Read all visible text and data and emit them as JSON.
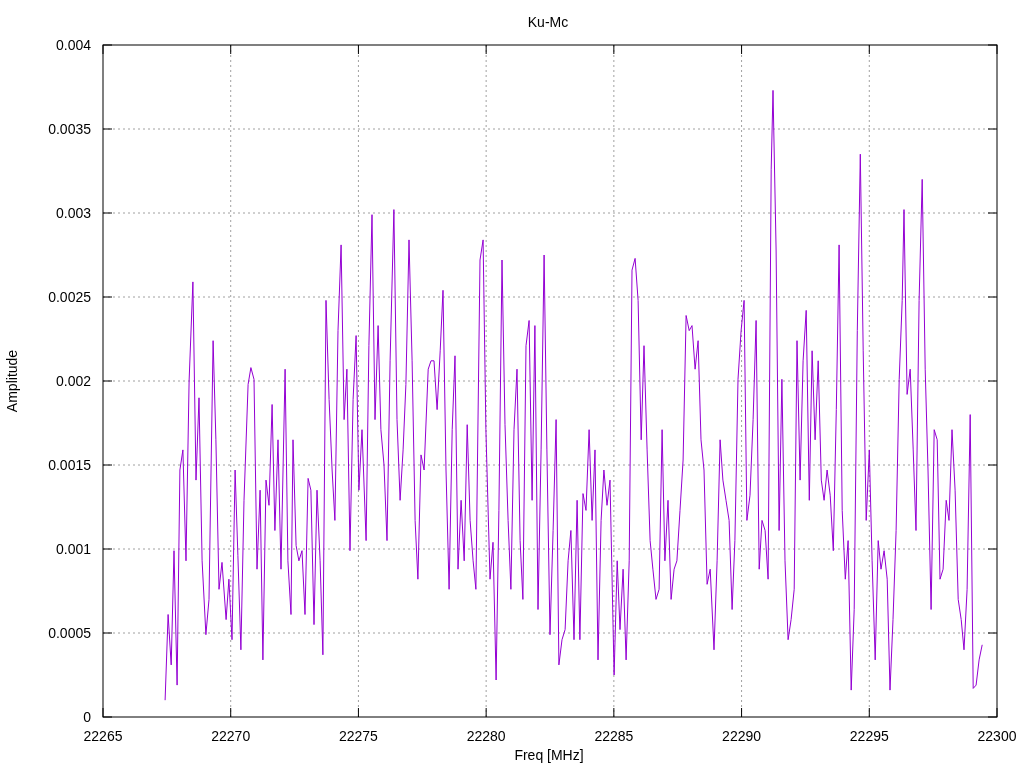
{
  "chart_data": {
    "type": "line",
    "grid": true,
    "title": "Ku-Mc",
    "xlabel": "Freq [MHz]",
    "ylabel": "Amplitude",
    "xlim": [
      22265,
      22300
    ],
    "ylim": [
      0,
      0.004
    ],
    "xticks": [
      22265,
      22270,
      22275,
      22280,
      22285,
      22290,
      22295,
      22300
    ],
    "yticks": [
      0,
      0.0005,
      0.001,
      0.0015,
      0.002,
      0.0025,
      0.003,
      0.0035,
      0.004
    ],
    "x": [
      22267.43,
      22267.55,
      22267.67,
      22267.78,
      22267.9,
      22268.01,
      22268.13,
      22268.25,
      22268.37,
      22268.52,
      22268.64,
      22268.76,
      22268.88,
      22269.03,
      22269.15,
      22269.31,
      22269.42,
      22269.54,
      22269.66,
      22269.82,
      22269.93,
      22270.05,
      22270.17,
      22270.28,
      22270.4,
      22270.52,
      22270.68,
      22270.79,
      22270.91,
      22271.03,
      22271.15,
      22271.26,
      22271.38,
      22271.5,
      22271.62,
      22271.73,
      22271.85,
      22271.97,
      22272.13,
      22272.24,
      22272.36,
      22272.44,
      22272.56,
      22272.67,
      22272.79,
      22272.91,
      22273.03,
      22273.14,
      22273.26,
      22273.38,
      22273.5,
      22273.61,
      22273.73,
      22273.85,
      22273.97,
      22274.08,
      22274.2,
      22274.32,
      22274.44,
      22274.55,
      22274.67,
      22274.79,
      22274.91,
      22275.02,
      22275.14,
      22275.3,
      22275.41,
      22275.53,
      22275.65,
      22275.77,
      22275.88,
      22276.0,
      22276.12,
      22276.24,
      22276.39,
      22276.51,
      22276.63,
      22276.75,
      22276.86,
      22276.98,
      22277.1,
      22277.22,
      22277.33,
      22277.45,
      22277.57,
      22277.73,
      22277.84,
      22277.96,
      22278.08,
      22278.2,
      22278.31,
      22278.43,
      22278.55,
      22278.67,
      22278.78,
      22278.9,
      22279.02,
      22279.14,
      22279.26,
      22279.37,
      22279.49,
      22279.6,
      22279.76,
      22279.88,
      22279.99,
      22280.15,
      22280.27,
      22280.39,
      22280.5,
      22280.62,
      22280.74,
      22280.86,
      22280.97,
      22281.09,
      22281.21,
      22281.33,
      22281.44,
      22281.56,
      22281.68,
      22281.8,
      22281.91,
      22282.03,
      22282.15,
      22282.27,
      22282.38,
      22282.5,
      22282.62,
      22282.74,
      22282.85,
      22282.97,
      22283.09,
      22283.21,
      22283.32,
      22283.44,
      22283.56,
      22283.67,
      22283.79,
      22283.91,
      22284.03,
      22284.15,
      22284.26,
      22284.38,
      22284.5,
      22284.61,
      22284.73,
      22284.85,
      22285.01,
      22285.13,
      22285.24,
      22285.36,
      22285.48,
      22285.6,
      22285.71,
      22285.83,
      22285.95,
      22286.07,
      22286.18,
      22286.3,
      22286.42,
      22286.53,
      22286.65,
      22286.77,
      22286.89,
      22287.0,
      22287.12,
      22287.24,
      22287.36,
      22287.47,
      22287.59,
      22287.71,
      22287.83,
      22287.95,
      22288.06,
      22288.18,
      22288.3,
      22288.41,
      22288.53,
      22288.65,
      22288.77,
      22288.92,
      22289.04,
      22289.16,
      22289.27,
      22289.39,
      22289.51,
      22289.63,
      22289.74,
      22289.86,
      22289.98,
      22290.1,
      22290.21,
      22290.33,
      22290.45,
      22290.57,
      22290.69,
      22290.8,
      22290.92,
      22291.04,
      22291.16,
      22291.23,
      22291.35,
      22291.47,
      22291.58,
      22291.7,
      22291.82,
      22291.94,
      22292.06,
      22292.17,
      22292.29,
      22292.41,
      22292.53,
      22292.65,
      22292.76,
      22292.88,
      22293.0,
      22293.12,
      22293.23,
      22293.35,
      22293.47,
      22293.59,
      22293.71,
      22293.82,
      22293.94,
      22294.06,
      22294.17,
      22294.29,
      22294.41,
      22294.53,
      22294.65,
      22294.76,
      22294.88,
      22295.0,
      22295.11,
      22295.23,
      22295.35,
      22295.46,
      22295.58,
      22295.7,
      22295.81,
      22295.93,
      22296.05,
      22296.17,
      22296.29,
      22296.36,
      22296.48,
      22296.6,
      22296.72,
      22296.83,
      22296.95,
      22297.07,
      22297.19,
      22297.3,
      22297.42,
      22297.54,
      22297.66,
      22297.77,
      22297.89,
      22298.01,
      22298.12,
      22298.24,
      22298.36,
      22298.48,
      22298.6,
      22298.71,
      22298.83,
      22298.95,
      22299.07,
      22299.18,
      22299.3,
      22299.42
    ],
    "series": [
      {
        "color": "#9400d3",
        "values": [
          0.0001,
          0.00061,
          0.00031,
          0.00099,
          0.00019,
          0.00147,
          0.00159,
          0.00093,
          0.002,
          0.00259,
          0.00141,
          0.0019,
          0.00093,
          0.00049,
          0.0007,
          0.00224,
          0.00165,
          0.00076,
          0.00092,
          0.00058,
          0.00082,
          0.00046,
          0.00147,
          0.00096,
          0.0004,
          0.00129,
          0.00198,
          0.00208,
          0.00201,
          0.00088,
          0.00135,
          0.00034,
          0.00141,
          0.00126,
          0.00186,
          0.00111,
          0.00165,
          0.00088,
          0.00207,
          0.00093,
          0.00061,
          0.00165,
          0.00102,
          0.00093,
          0.00099,
          0.00061,
          0.00142,
          0.00135,
          0.00055,
          0.00135,
          0.00093,
          0.00037,
          0.00248,
          0.00189,
          0.00147,
          0.00117,
          0.0023,
          0.00281,
          0.00177,
          0.00207,
          0.00099,
          0.00189,
          0.00227,
          0.00135,
          0.00171,
          0.00105,
          0.00221,
          0.00299,
          0.00177,
          0.00233,
          0.00171,
          0.0015,
          0.00105,
          0.00212,
          0.00302,
          0.00177,
          0.00129,
          0.00159,
          0.00198,
          0.00284,
          0.00212,
          0.00117,
          0.00082,
          0.00156,
          0.00147,
          0.00207,
          0.00212,
          0.00212,
          0.00183,
          0.00218,
          0.00254,
          0.00147,
          0.00076,
          0.00171,
          0.00215,
          0.00088,
          0.00129,
          0.00093,
          0.00174,
          0.00117,
          0.00093,
          0.00076,
          0.00272,
          0.00284,
          0.00171,
          0.00082,
          0.00104,
          0.00022,
          0.00123,
          0.00272,
          0.00174,
          0.00117,
          0.00076,
          0.00171,
          0.00207,
          0.00105,
          0.0007,
          0.00221,
          0.00236,
          0.00129,
          0.00233,
          0.00064,
          0.00159,
          0.00275,
          0.00159,
          0.00049,
          0.00111,
          0.00177,
          0.00031,
          0.00046,
          0.00052,
          0.00093,
          0.00111,
          0.00046,
          0.00129,
          0.00046,
          0.00133,
          0.00123,
          0.00171,
          0.00117,
          0.00159,
          0.00034,
          0.00117,
          0.00147,
          0.00126,
          0.00141,
          0.00025,
          0.00093,
          0.00052,
          0.00088,
          0.00034,
          0.00093,
          0.00266,
          0.00273,
          0.00248,
          0.00165,
          0.00221,
          0.00159,
          0.00105,
          0.00088,
          0.0007,
          0.00076,
          0.00171,
          0.00093,
          0.00129,
          0.0007,
          0.00088,
          0.00093,
          0.00123,
          0.00153,
          0.00239,
          0.0023,
          0.00233,
          0.00207,
          0.00224,
          0.00165,
          0.00147,
          0.00079,
          0.00088,
          0.0004,
          0.00093,
          0.00165,
          0.00141,
          0.00129,
          0.00117,
          0.00064,
          0.00105,
          0.00201,
          0.0023,
          0.00248,
          0.00117,
          0.00132,
          0.00177,
          0.00236,
          0.00088,
          0.00117,
          0.00111,
          0.00082,
          0.00326,
          0.00373,
          0.00278,
          0.00111,
          0.00201,
          0.00093,
          0.00046,
          0.00058,
          0.00076,
          0.00224,
          0.00141,
          0.00212,
          0.00242,
          0.00129,
          0.00218,
          0.00165,
          0.00212,
          0.00141,
          0.00129,
          0.00147,
          0.00132,
          0.00099,
          0.00183,
          0.00281,
          0.00123,
          0.00082,
          0.00105,
          0.00016,
          0.00064,
          0.0023,
          0.00335,
          0.00218,
          0.00117,
          0.00159,
          0.00093,
          0.00034,
          0.00105,
          0.00088,
          0.00099,
          0.00082,
          0.00016,
          0.00058,
          0.00111,
          0.00201,
          0.00248,
          0.00302,
          0.00192,
          0.00207,
          0.00159,
          0.00111,
          0.00248,
          0.0032,
          0.00207,
          0.00147,
          0.00064,
          0.00171,
          0.00165,
          0.00082,
          0.00088,
          0.00129,
          0.00117,
          0.00171,
          0.00135,
          0.0007,
          0.00058,
          0.0004,
          0.00076,
          0.0018,
          0.00017,
          0.00019,
          0.00034,
          0.00043
        ]
      }
    ]
  }
}
